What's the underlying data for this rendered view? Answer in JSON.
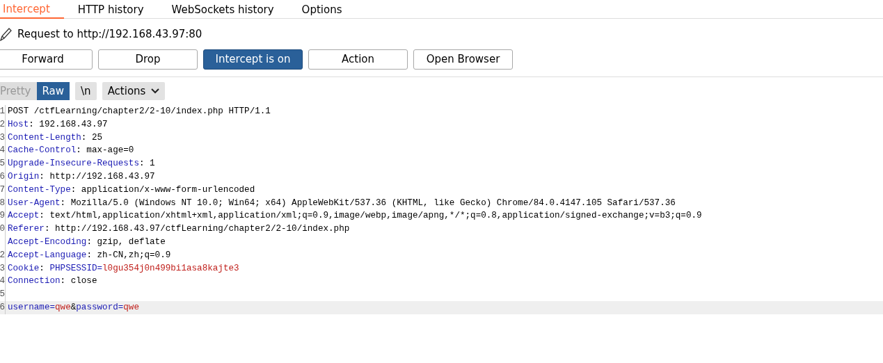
{
  "tabs": [
    {
      "label": "Intercept",
      "selected": true
    },
    {
      "label": "HTTP history",
      "selected": false
    },
    {
      "label": "WebSockets history",
      "selected": false
    },
    {
      "label": "Options",
      "selected": false
    }
  ],
  "request_title": "Request to http://192.168.43.97:80",
  "buttons": [
    {
      "label": "Forward",
      "active": false
    },
    {
      "label": "Drop",
      "active": false
    },
    {
      "label": "Intercept is on",
      "active": true
    },
    {
      "label": "Action",
      "active": false
    },
    {
      "label": "Open Browser",
      "active": false
    }
  ],
  "view_toggle": [
    {
      "label": "Pretty",
      "selected": false
    },
    {
      "label": "Raw",
      "selected": true
    }
  ],
  "newline_button": "\\n",
  "actions_menu": "Actions",
  "editor_lines": [
    {
      "gutter": "1",
      "current": false,
      "segments": [
        {
          "kind": "plain",
          "text": "POST /ctfLearning/chapter2/2-10/index.php HTTP/1.1"
        }
      ]
    },
    {
      "gutter": "2",
      "current": false,
      "segments": [
        {
          "kind": "name",
          "text": "Host"
        },
        {
          "kind": "plain",
          "text": ": 192.168.43.97"
        }
      ]
    },
    {
      "gutter": "3",
      "current": false,
      "segments": [
        {
          "kind": "name",
          "text": "Content-Length"
        },
        {
          "kind": "plain",
          "text": ": 25"
        }
      ]
    },
    {
      "gutter": "4",
      "current": false,
      "segments": [
        {
          "kind": "name",
          "text": "Cache-Control"
        },
        {
          "kind": "plain",
          "text": ": max-age=0"
        }
      ]
    },
    {
      "gutter": "5",
      "current": false,
      "segments": [
        {
          "kind": "name",
          "text": "Upgrade-Insecure-Requests"
        },
        {
          "kind": "plain",
          "text": ": 1"
        }
      ]
    },
    {
      "gutter": "6",
      "current": false,
      "segments": [
        {
          "kind": "name",
          "text": "Origin"
        },
        {
          "kind": "plain",
          "text": ": http://192.168.43.97"
        }
      ]
    },
    {
      "gutter": "7",
      "current": false,
      "segments": [
        {
          "kind": "name",
          "text": "Content-Type"
        },
        {
          "kind": "plain",
          "text": ": application/x-www-form-urlencoded"
        }
      ]
    },
    {
      "gutter": "8",
      "current": false,
      "segments": [
        {
          "kind": "name",
          "text": "User-Agent"
        },
        {
          "kind": "plain",
          "text": ": Mozilla/5.0 (Windows NT 10.0; Win64; x64) AppleWebKit/537.36 (KHTML, like Gecko) Chrome/84.0.4147.105 Safari/537.36"
        }
      ]
    },
    {
      "gutter": "9",
      "current": false,
      "segments": [
        {
          "kind": "name",
          "text": "Accept"
        },
        {
          "kind": "plain",
          "text": ": text/html,application/xhtml+xml,application/xml;q=0.9,image/webp,image/apng,*/*;q=0.8,application/signed-exchange;v=b3;q=0.9"
        }
      ]
    },
    {
      "gutter": "0",
      "current": false,
      "segments": [
        {
          "kind": "name",
          "text": "Referer"
        },
        {
          "kind": "plain",
          "text": ": http://192.168.43.97/ctfLearning/chapter2/2-10/index.php"
        }
      ]
    },
    {
      "current": false,
      "segments": [
        {
          "kind": "name",
          "text": "Accept-Encoding"
        },
        {
          "kind": "plain",
          "text": ": gzip, deflate"
        }
      ]
    },
    {
      "gutter": "2",
      "current": false,
      "segments": [
        {
          "kind": "name",
          "text": "Accept-Language"
        },
        {
          "kind": "plain",
          "text": ": zh-CN,zh;q=0.9"
        }
      ]
    },
    {
      "gutter": "3",
      "current": false,
      "segments": [
        {
          "kind": "name",
          "text": "Cookie"
        },
        {
          "kind": "plain",
          "text": ": "
        },
        {
          "kind": "name",
          "text": "PHPSESSID="
        },
        {
          "kind": "value",
          "text": "l0gu354j0n499bi1asa8kajte3"
        }
      ]
    },
    {
      "gutter": "4",
      "current": false,
      "segments": [
        {
          "kind": "name",
          "text": "Connection"
        },
        {
          "kind": "plain",
          "text": ": close"
        }
      ]
    },
    {
      "gutter": "5",
      "current": false
    },
    {
      "gutter": "6",
      "current": true,
      "segments": [
        {
          "kind": "name",
          "text": "username="
        },
        {
          "kind": "value",
          "text": "qwe"
        },
        {
          "kind": "plain",
          "text": "&"
        },
        {
          "kind": "name",
          "text": "password="
        },
        {
          "kind": "value",
          "text": "qwe"
        }
      ]
    }
  ]
}
